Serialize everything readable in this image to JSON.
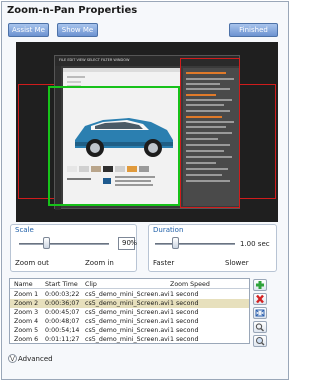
{
  "panel": {
    "title": "Zoom-n-Pan Properties",
    "buttons": {
      "assist": "Assist Me",
      "show": "Show Me",
      "finished": "Finished"
    }
  },
  "preview": {
    "app_menu": "FILE  EDIT  VIEW  SELECT  FILTER  WINDOW",
    "panel_title": "MINI COOPER"
  },
  "scale": {
    "label": "Scale",
    "value": "90",
    "unit": "%",
    "min_label": "Zoom out",
    "max_label": "Zoom in",
    "level": 0.3
  },
  "duration": {
    "label": "Duration",
    "value_text": "1.00 sec",
    "min_label": "Faster",
    "max_label": "Slower",
    "level": 0.25
  },
  "zoom_list": {
    "columns": [
      "Name",
      "Start Time",
      "Clip",
      "Zoom Speed"
    ],
    "rows": [
      [
        "Zoom 1",
        "0:00:03;22",
        "cs5_demo_mini_Screen.avi",
        "1 second"
      ],
      [
        "Zoom 2",
        "0:00:36;07",
        "cs5_demo_mini_Screen.avi",
        "1 second"
      ],
      [
        "Zoom 3",
        "0:00:45;07",
        "cs5_demo_mini_Screen.avi",
        "1 second"
      ],
      [
        "Zoom 4",
        "0:00:48;07",
        "cs5_demo_mini_Screen.avi",
        "1 second"
      ],
      [
        "Zoom 5",
        "0:00:54;14",
        "cs5_demo_mini_Screen.avi",
        "1 second"
      ],
      [
        "Zoom 6",
        "0:01:11;27",
        "cs5_demo_mini_Screen.avi",
        "1 second"
      ]
    ],
    "selected_row": 1
  },
  "side_actions": [
    "add-icon",
    "delete-icon",
    "fit-icon",
    "zoom-icon",
    "search-icon"
  ],
  "advanced": {
    "label": "Advanced"
  },
  "colors": {
    "accent": "#1f5fa8",
    "button": "#6d93d1",
    "frame_red": "#d01c1c",
    "frame_green": "#17c21a",
    "selection": "#e7e0bd"
  }
}
